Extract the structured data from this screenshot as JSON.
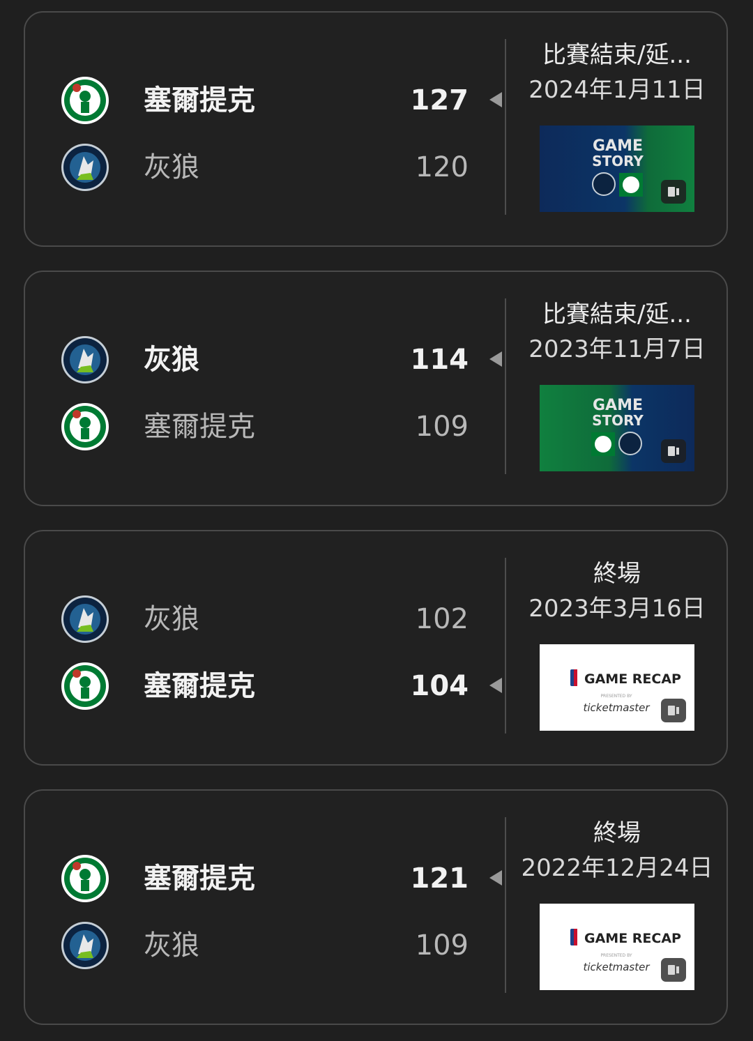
{
  "games": [
    {
      "teams": [
        {
          "name": "塞爾提克",
          "score": "127",
          "logo": "celtics-logo",
          "winner": true
        },
        {
          "name": "灰狼",
          "score": "120",
          "logo": "timberwolves-logo",
          "winner": false
        }
      ],
      "status": "比賽結束/延...",
      "date": "2024年1月11日",
      "thumbnail": {
        "type": "game-story",
        "line1": "GAME",
        "line2": "STORY",
        "bg": "blue-green"
      }
    },
    {
      "teams": [
        {
          "name": "灰狼",
          "score": "114",
          "logo": "timberwolves-logo",
          "winner": true
        },
        {
          "name": "塞爾提克",
          "score": "109",
          "logo": "celtics-logo",
          "winner": false
        }
      ],
      "status": "比賽結束/延...",
      "date": "2023年11月7日",
      "thumbnail": {
        "type": "game-story",
        "line1": "GAME",
        "line2": "STORY",
        "bg": "green-blue"
      }
    },
    {
      "teams": [
        {
          "name": "灰狼",
          "score": "102",
          "logo": "timberwolves-logo",
          "winner": false
        },
        {
          "name": "塞爾提克",
          "score": "104",
          "logo": "celtics-logo",
          "winner": true
        }
      ],
      "status": "終場",
      "date": "2023年3月16日",
      "thumbnail": {
        "type": "game-recap",
        "title": "GAME RECAP",
        "presented": "PRESENTED BY",
        "sponsor": "ticketmaster"
      }
    },
    {
      "teams": [
        {
          "name": "塞爾提克",
          "score": "121",
          "logo": "celtics-logo",
          "winner": true
        },
        {
          "name": "灰狼",
          "score": "109",
          "logo": "timberwolves-logo",
          "winner": false
        }
      ],
      "status": "終場",
      "date": "2022年12月24日",
      "thumbnail": {
        "type": "game-recap",
        "title": "GAME RECAP",
        "presented": "PRESENTED BY",
        "sponsor": "ticketmaster"
      }
    }
  ],
  "colors": {
    "celtics_green": "#007a33",
    "timberwolves_navy": "#0c2340",
    "background": "#1f1f1f"
  }
}
